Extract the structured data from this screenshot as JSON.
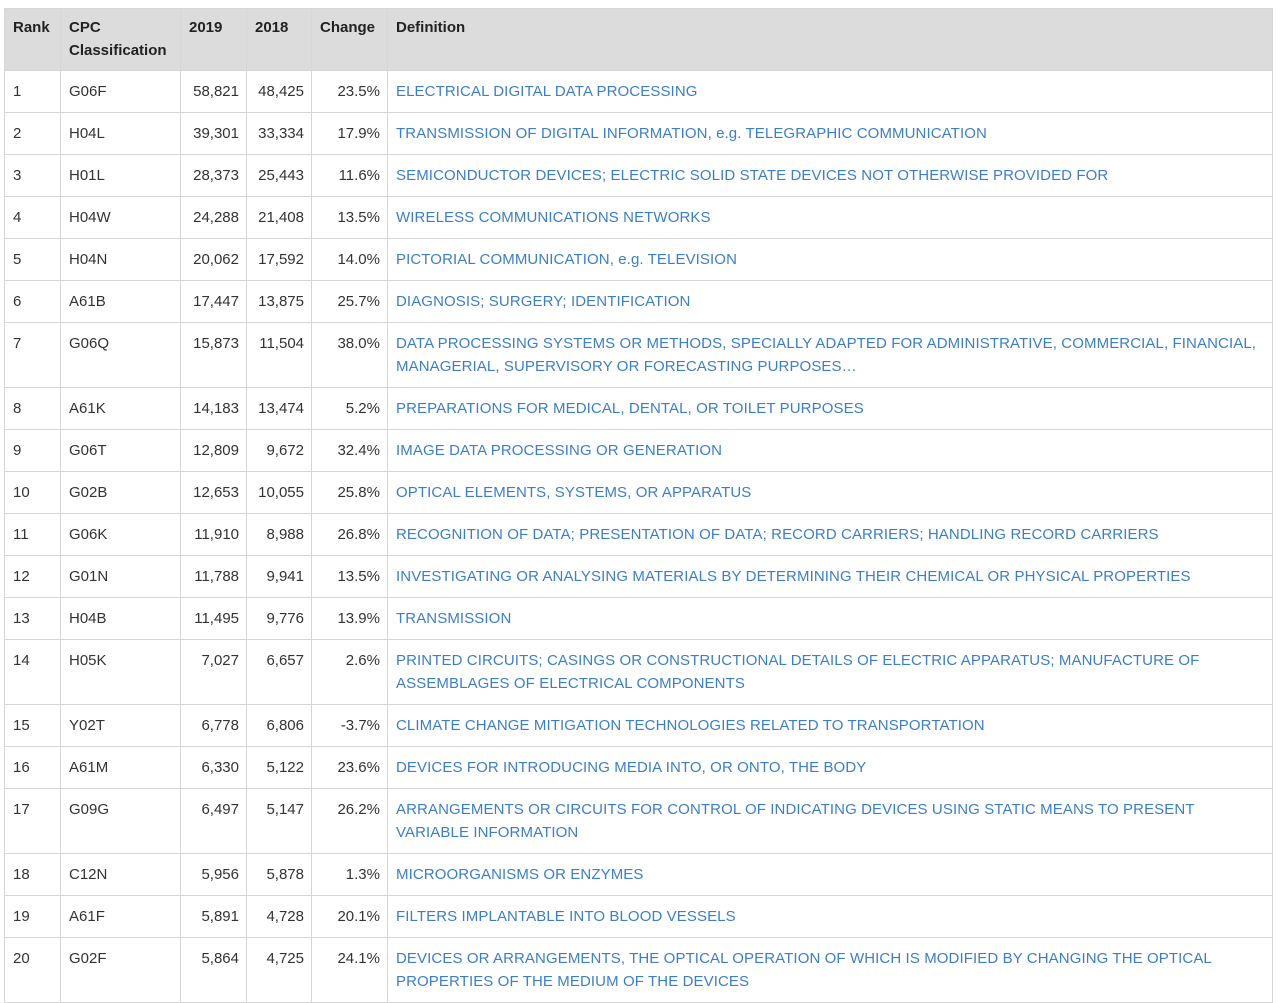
{
  "headers": {
    "rank": "Rank",
    "cpc_line1": "CPC",
    "cpc_line2": "Classification",
    "y2019": "2019",
    "y2018": "2018",
    "change": "Change",
    "definition": "Definition"
  },
  "colors": {
    "header_bg": "#dcdcdc",
    "link": "#3d7fc6",
    "border": "#d7d7d7"
  },
  "rows": [
    {
      "rank": "1",
      "cpc": "G06F",
      "y2019": "58,821",
      "y2018": "48,425",
      "change": "23.5%",
      "definition": "ELECTRICAL DIGITAL DATA PROCESSING"
    },
    {
      "rank": "2",
      "cpc": "H04L",
      "y2019": "39,301",
      "y2018": "33,334",
      "change": "17.9%",
      "definition": "TRANSMISSION OF DIGITAL INFORMATION, e.g. TELEGRAPHIC COMMUNICATION"
    },
    {
      "rank": "3",
      "cpc": "H01L",
      "y2019": "28,373",
      "y2018": "25,443",
      "change": "11.6%",
      "definition": "SEMICONDUCTOR DEVICES; ELECTRIC SOLID STATE DEVICES NOT OTHERWISE PROVIDED FOR"
    },
    {
      "rank": "4",
      "cpc": "H04W",
      "y2019": "24,288",
      "y2018": "21,408",
      "change": "13.5%",
      "definition": "WIRELESS COMMUNICATIONS NETWORKS"
    },
    {
      "rank": "5",
      "cpc": "H04N",
      "y2019": "20,062",
      "y2018": "17,592",
      "change": "14.0%",
      "definition": "PICTORIAL COMMUNICATION, e.g. TELEVISION"
    },
    {
      "rank": "6",
      "cpc": "A61B",
      "y2019": "17,447",
      "y2018": "13,875",
      "change": "25.7%",
      "definition": "DIAGNOSIS; SURGERY; IDENTIFICATION"
    },
    {
      "rank": "7",
      "cpc": "G06Q",
      "y2019": "15,873",
      "y2018": "11,504",
      "change": "38.0%",
      "definition": "DATA PROCESSING SYSTEMS OR METHODS, SPECIALLY ADAPTED FOR ADMINISTRATIVE, COMMERCIAL, FINANCIAL, MANAGERIAL, SUPERVISORY OR FORECASTING PURPOSES…"
    },
    {
      "rank": "8",
      "cpc": "A61K",
      "y2019": "14,183",
      "y2018": "13,474",
      "change": "5.2%",
      "definition": "PREPARATIONS FOR MEDICAL, DENTAL, OR TOILET PURPOSES"
    },
    {
      "rank": "9",
      "cpc": "G06T",
      "y2019": "12,809",
      "y2018": "9,672",
      "change": "32.4%",
      "definition": "IMAGE DATA PROCESSING OR GENERATION"
    },
    {
      "rank": "10",
      "cpc": "G02B",
      "y2019": "12,653",
      "y2018": "10,055",
      "change": "25.8%",
      "definition": "OPTICAL ELEMENTS, SYSTEMS, OR APPARATUS"
    },
    {
      "rank": "11",
      "cpc": "G06K",
      "y2019": "11,910",
      "y2018": "8,988",
      "change": "26.8%",
      "definition": "RECOGNITION OF DATA; PRESENTATION OF DATA; RECORD CARRIERS; HANDLING RECORD CARRIERS"
    },
    {
      "rank": "12",
      "cpc": "G01N",
      "y2019": "11,788",
      "y2018": "9,941",
      "change": "13.5%",
      "definition": "INVESTIGATING OR ANALYSING MATERIALS BY DETERMINING THEIR CHEMICAL OR PHYSICAL PROPERTIES"
    },
    {
      "rank": "13",
      "cpc": "H04B",
      "y2019": "11,495",
      "y2018": "9,776",
      "change": "13.9%",
      "definition": "TRANSMISSION"
    },
    {
      "rank": "14",
      "cpc": "H05K",
      "y2019": "7,027",
      "y2018": "6,657",
      "change": "2.6%",
      "definition": "PRINTED CIRCUITS; CASINGS OR CONSTRUCTIONAL DETAILS OF ELECTRIC APPARATUS; MANUFACTURE OF ASSEMBLAGES OF ELECTRICAL COMPONENTS"
    },
    {
      "rank": "15",
      "cpc": "Y02T",
      "y2019": "6,778",
      "y2018": "6,806",
      "change": "-3.7%",
      "definition": "CLIMATE CHANGE MITIGATION TECHNOLOGIES RELATED TO TRANSPORTATION"
    },
    {
      "rank": "16",
      "cpc": "A61M",
      "y2019": "6,330",
      "y2018": "5,122",
      "change": "23.6%",
      "definition": "DEVICES FOR INTRODUCING MEDIA INTO, OR ONTO, THE BODY"
    },
    {
      "rank": "17",
      "cpc": "G09G",
      "y2019": "6,497",
      "y2018": "5,147",
      "change": "26.2%",
      "definition": "ARRANGEMENTS OR CIRCUITS FOR CONTROL OF INDICATING DEVICES USING STATIC MEANS TO PRESENT VARIABLE INFORMATION"
    },
    {
      "rank": "18",
      "cpc": "C12N",
      "y2019": "5,956",
      "y2018": "5,878",
      "change": "1.3%",
      "definition": "MICROORGANISMS OR ENZYMES"
    },
    {
      "rank": "19",
      "cpc": "A61F",
      "y2019": "5,891",
      "y2018": "4,728",
      "change": "20.1%",
      "definition": "FILTERS IMPLANTABLE INTO BLOOD VESSELS"
    },
    {
      "rank": "20",
      "cpc": "G02F",
      "y2019": "5,864",
      "y2018": "4,725",
      "change": "24.1%",
      "definition": "DEVICES OR ARRANGEMENTS, THE OPTICAL OPERATION OF WHICH IS MODIFIED BY CHANGING THE OPTICAL PROPERTIES OF THE MEDIUM OF THE DEVICES"
    }
  ]
}
